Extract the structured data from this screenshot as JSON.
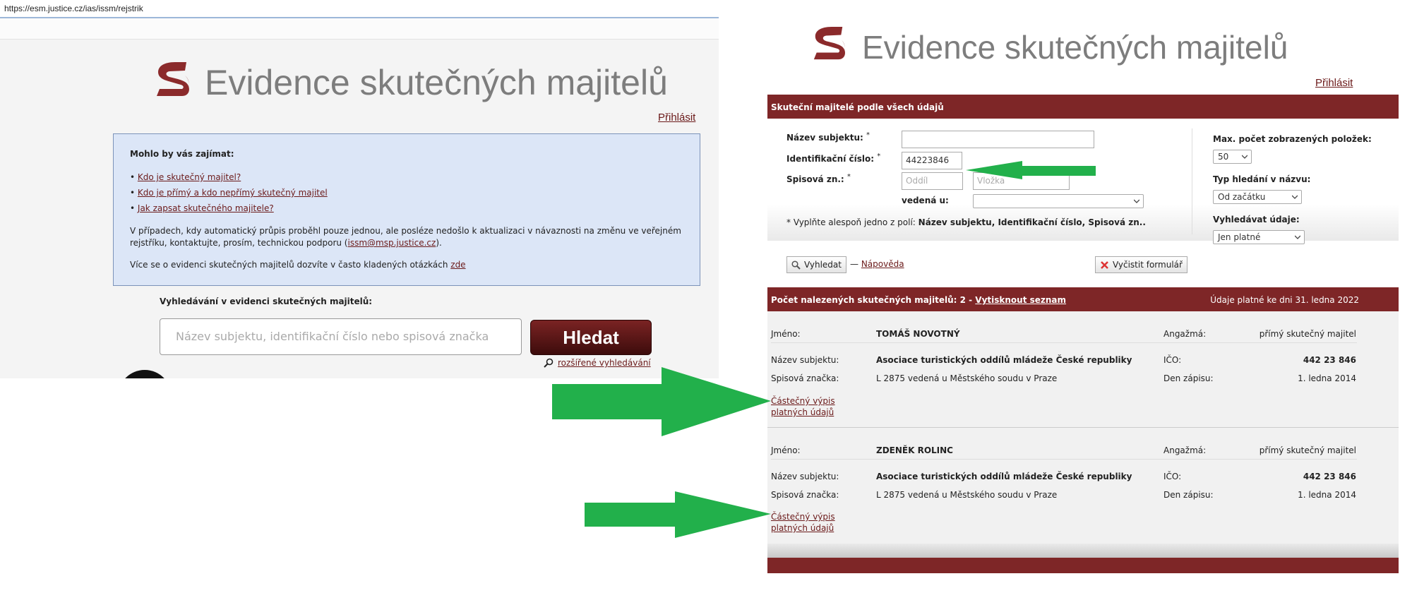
{
  "browser": {
    "url": "https://esm.justice.cz/ias/issm/rejstrik"
  },
  "left": {
    "title": "Evidence skutečných majitelů",
    "login": "Přihlásit",
    "infobox": {
      "heading": "Mohlo by vás zajímat:",
      "links": [
        "Kdo je skutečný majitel?",
        "Kdo je přímý a kdo nepřímý skutečný majitel",
        "Jak zapsat skutečného majitele?"
      ],
      "p1_before": "V případech, kdy automatický průpis proběhl pouze jednou, ale posléze nedošlo k aktualizaci v návaznosti na změnu ve veřejném rejstříku, kontaktujte, prosím, technickou podporu (",
      "p1_email": "issm@msp.justice.cz",
      "p1_after": ").",
      "p2_before": "Více se o evidenci skutečných majitelů dozvíte v často kladených otázkách ",
      "p2_link": "zde"
    },
    "search": {
      "label": "Vyhledávání v evidenci skutečných majitelů:",
      "placeholder": "Název subjektu, identifikační číslo nebo spisová značka",
      "button": "Hledat",
      "advanced": "rozšířené vyhledávání"
    }
  },
  "right": {
    "title": "Evidence skutečných majitelů",
    "login": "Přihlásit",
    "section_title": "Skuteční majitelé podle všech údajů",
    "form": {
      "name_label": "Název subjektu:",
      "ico_label": "Identifikační číslo:",
      "ico_value": "44223846",
      "spis_label": "Spisová zn.:",
      "oddil_placeholder": "Oddíl",
      "vlozka_placeholder": "Vložka",
      "vedena_label": "vedená u:",
      "note_prefix": "* Vyplňte alespoň jedno z polí: ",
      "note_fields": "Název subjektu, Identifikační číslo, Spisová zn..",
      "max_label": "Max. počet zobrazených položek:",
      "max_value": "50",
      "typ_label": "Typ hledání v názvu:",
      "typ_value": "Od začátku",
      "vyhl_label": "Vyhledávat údaje:",
      "vyhl_value": "Jen platné",
      "search_button": "Vyhledat",
      "dash": "—",
      "help_link": "Nápověda",
      "clear_button": "Vyčistit formulář",
      "asterisk": "*"
    },
    "results_bar": {
      "count_label": "Počet nalezených skutečných majitelů: 2 - ",
      "print_link": "Vytisknout seznam",
      "valid_text": "Údaje platné ke dni 31. ledna 2022"
    },
    "labels": {
      "jmeno": "Jméno:",
      "nazev": "Název subjektu:",
      "spis": "Spisová značka:",
      "angazma": "Angažmá:",
      "ico": "IČO:",
      "den": "Den zápisu:",
      "link_line1": "Částečný výpis",
      "link_line2": "platných údajů"
    },
    "results": [
      {
        "name": "TOMÁŠ NOVOTNÝ",
        "subject": "Asociace turistických oddílů mládeže České republiky",
        "file": "L 2875 vedená u Městského soudu v Praze",
        "role": "přímý skutečný majitel",
        "ico": "442 23 846",
        "date": "1. ledna 2014"
      },
      {
        "name": "ZDENĚK ROLINC",
        "subject": "Asociace turistických oddílů mládeže České republiky",
        "file": "L 2875 vedená u Městského soudu v Praze",
        "role": "přímý skutečný majitel",
        "ico": "442 23 846",
        "date": "1. ledna 2014"
      }
    ]
  },
  "colors": {
    "brand": "#7e2627",
    "arrow": "#22b04b",
    "infobox": "#dce6f7"
  },
  "icons": [
    "logo-icon",
    "magnifier-icon",
    "clear-x-icon",
    "caret-down-icon",
    "arrow-annotation"
  ]
}
